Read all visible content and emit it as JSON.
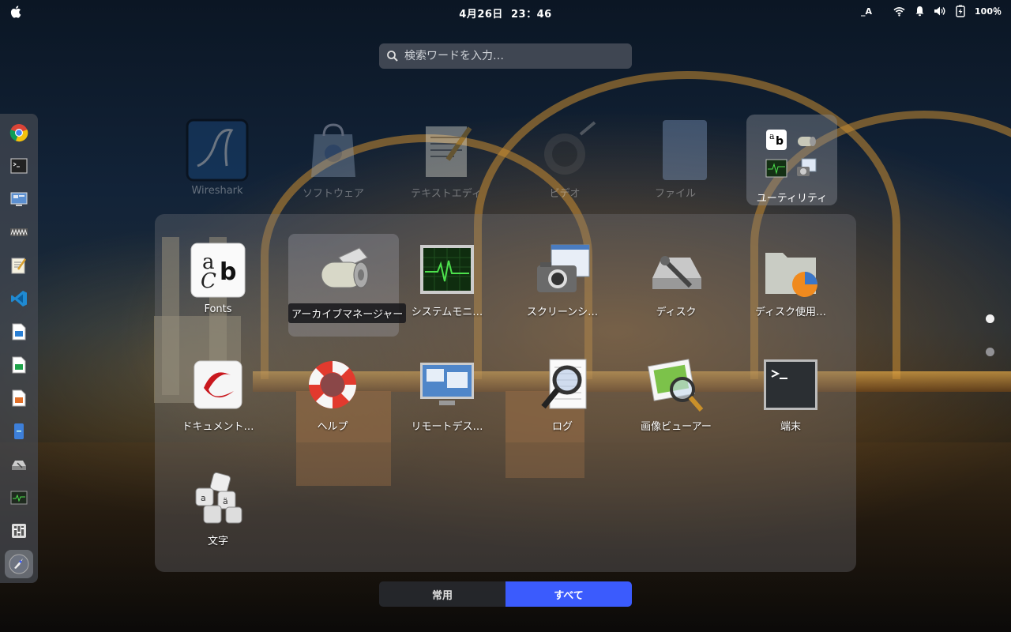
{
  "topbar": {
    "date": "4月26日",
    "time": "23：46",
    "input_method": "_A",
    "battery_text": "100％"
  },
  "search": {
    "placeholder": "検索ワードを入力…"
  },
  "dock": {
    "items": [
      "chrome-icon",
      "terminal-icon",
      "remote-desktop-icon",
      "wireshark-icon",
      "text-editor-icon",
      "vscode-icon",
      "writer-icon",
      "calc-icon",
      "impress-icon",
      "files-icon",
      "disk-icon",
      "system-monitor-icon",
      "mixer-icon",
      "launcher-icon"
    ]
  },
  "background_apps": [
    {
      "label": "Wireshark"
    },
    {
      "label": "ソフトウェア"
    },
    {
      "label": "テキストエディ"
    },
    {
      "label": "ビデオ"
    },
    {
      "label": "ファイル"
    }
  ],
  "utilities_folder": {
    "label": "ユーティリティ"
  },
  "folder_apps": [
    {
      "label": "Fonts"
    },
    {
      "label": "アーカイブマネージャー"
    },
    {
      "label": "システムモニ…"
    },
    {
      "label": "スクリーンシ…"
    },
    {
      "label": "ディスク"
    },
    {
      "label": "ディスク使用…"
    },
    {
      "label": "ドキュメント…"
    },
    {
      "label": "ヘルプ"
    },
    {
      "label": "リモートデス…"
    },
    {
      "label": "ログ"
    },
    {
      "label": "画像ビューアー"
    },
    {
      "label": "端末"
    },
    {
      "label": "文字"
    }
  ],
  "tabs": {
    "frequent": "常用",
    "all": "すべて"
  },
  "colors": {
    "accent": "#3b5bfd"
  }
}
